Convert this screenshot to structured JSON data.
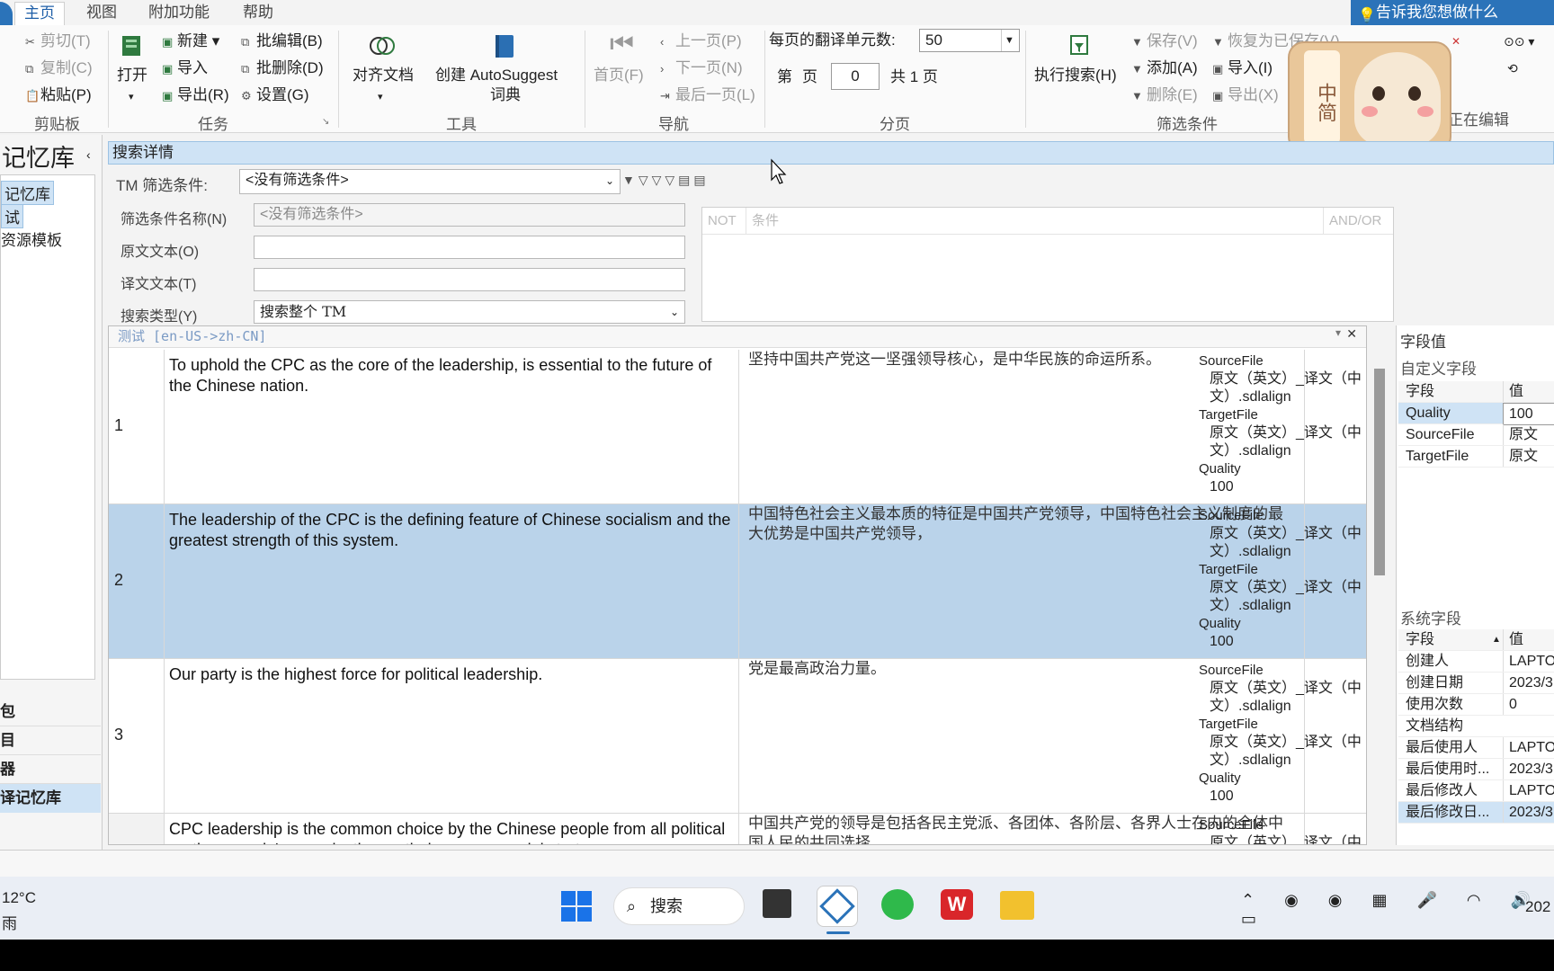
{
  "ribbon_tabs": {
    "home": "主页",
    "view": "视图",
    "addins": "附加功能",
    "help": "帮助"
  },
  "tell_me": "告诉我您想做什么",
  "clipboard": {
    "cut": "剪切(T)",
    "copy": "复制(C)",
    "paste": "粘贴(P)",
    "group": "剪贴板"
  },
  "tasks": {
    "open": "打开",
    "new": "新建",
    "import": "导入",
    "export": "导出(R)",
    "batch_edit": "批编辑(B)",
    "batch_delete": "批删除(D)",
    "settings": "设置(G)",
    "group": "任务"
  },
  "tools": {
    "align": "对齐文档",
    "autosuggest_1": "创建 AutoSuggest",
    "autosuggest_2": "词典",
    "group": "工具"
  },
  "navigation": {
    "first": "首页(F)",
    "prev": "上一页(P)",
    "next": "下一页(N)",
    "last": "最后一页(L)",
    "group": "导航"
  },
  "paging": {
    "units_label": "每页的翻译单元数:",
    "units_value": "50",
    "page_label_pre": "第",
    "page_label_mid": "页",
    "page_value": "0",
    "total": "共 1 页",
    "group": "分页"
  },
  "filter": {
    "run": "执行搜索(H)",
    "save": "保存(V)",
    "restore": "恢复为已保存(V)",
    "add": "添加(A)",
    "delete": "删除(E)",
    "import": "导入(I)",
    "export": "导出(X)",
    "group": "筛选条件"
  },
  "editing_group": "正在编辑",
  "leftnav": {
    "title": "记忆库",
    "items": [
      "记忆库",
      "试",
      "资源模板"
    ],
    "bottom": [
      "包",
      "目",
      "器",
      "译记忆库"
    ]
  },
  "search": {
    "header": "搜索详情",
    "tm_filter_label": "TM 筛选条件:",
    "tm_filter_value": "<没有筛选条件>",
    "filter_name_label": "筛选条件名称(N)",
    "filter_name_value": "<没有筛选条件>",
    "source_label": "原文文本(O)",
    "target_label": "译文文本(T)",
    "search_type_label": "搜索类型(Y)",
    "search_type_value": "搜索整个 TM",
    "cond_not": "NOT",
    "cond_condition": "条件",
    "cond_andor": "AND/OR"
  },
  "grid": {
    "title": "测试 [en-US->zh-CN]",
    "rows": [
      {
        "num": "1",
        "source": "To uphold the CPC as the core of the leadership, is essential to the future of the Chinese nation.",
        "target": "坚持中国共产党这一坚强领导核心，是中华民族的命运所系。",
        "source_file_label": "SourceFile",
        "source_file": "原文（英文）_译文（中文）.sdlalign",
        "target_file_label": "TargetFile",
        "target_file": "原文（英文）_译文（中文）.sdlalign",
        "quality_label": "Quality",
        "quality": "100"
      },
      {
        "num": "2",
        "source": "The leadership of the CPC is the defining feature of Chinese socialism and the greatest strength of this system.",
        "target": "中国特色社会主义最本质的特征是中国共产党领导，中国特色社会主义制度的最大优势是中国共产党领导，",
        "source_file_label": "SourceFile",
        "source_file": "原文（英文）_译文（中文）.sdlalign",
        "target_file_label": "TargetFile",
        "target_file": "原文（英文）_译文（中文）.sdlalign",
        "quality_label": "Quality",
        "quality": "100"
      },
      {
        "num": "3",
        "source": "Our party is the highest force for political leadership.",
        "target": "党是最高政治力量。",
        "source_file_label": "SourceFile",
        "source_file": "原文（英文）_译文（中文）.sdlalign",
        "target_file_label": "TargetFile",
        "target_file": "原文（英文）_译文（中文）.sdlalign",
        "quality_label": "Quality",
        "quality": "100"
      },
      {
        "num": "",
        "source": "CPC leadership is the common choice by the Chinese people from all political parties, people's organizations, ethnic groups, social strata",
        "target": "中国共产党的领导是包括各民主党派、各团体、各阶层、各界人士在内的全体中国人民的共同选择",
        "source_file_label": "SourceFile",
        "source_file": "原文（英文）_译文（中",
        "target_file_label": "",
        "target_file": "",
        "quality_label": "",
        "quality": ""
      }
    ]
  },
  "fields_panel": {
    "title": "字段值",
    "custom_title": "自定义字段",
    "col_field": "字段",
    "col_value": "值",
    "custom": [
      {
        "k": "Quality",
        "v": "100"
      },
      {
        "k": "SourceFile",
        "v": "原文"
      },
      {
        "k": "TargetFile",
        "v": "原文"
      }
    ],
    "system_title": "系统字段",
    "system": [
      {
        "k": "创建人",
        "v": "LAPTO"
      },
      {
        "k": "创建日期",
        "v": "2023/3"
      },
      {
        "k": "使用次数",
        "v": "0"
      },
      {
        "k": "文档结构",
        "v": ""
      },
      {
        "k": "最后使用人",
        "v": "LAPTO"
      },
      {
        "k": "最后使用时...",
        "v": "2023/3"
      },
      {
        "k": "最后修改人",
        "v": "LAPTO"
      },
      {
        "k": "最后修改日...",
        "v": "2023/3"
      }
    ]
  },
  "taskbar": {
    "weather_temp": "12°C",
    "weather_desc": "雨",
    "search": "搜索",
    "clock": "202"
  },
  "overlay_badge": "中简"
}
